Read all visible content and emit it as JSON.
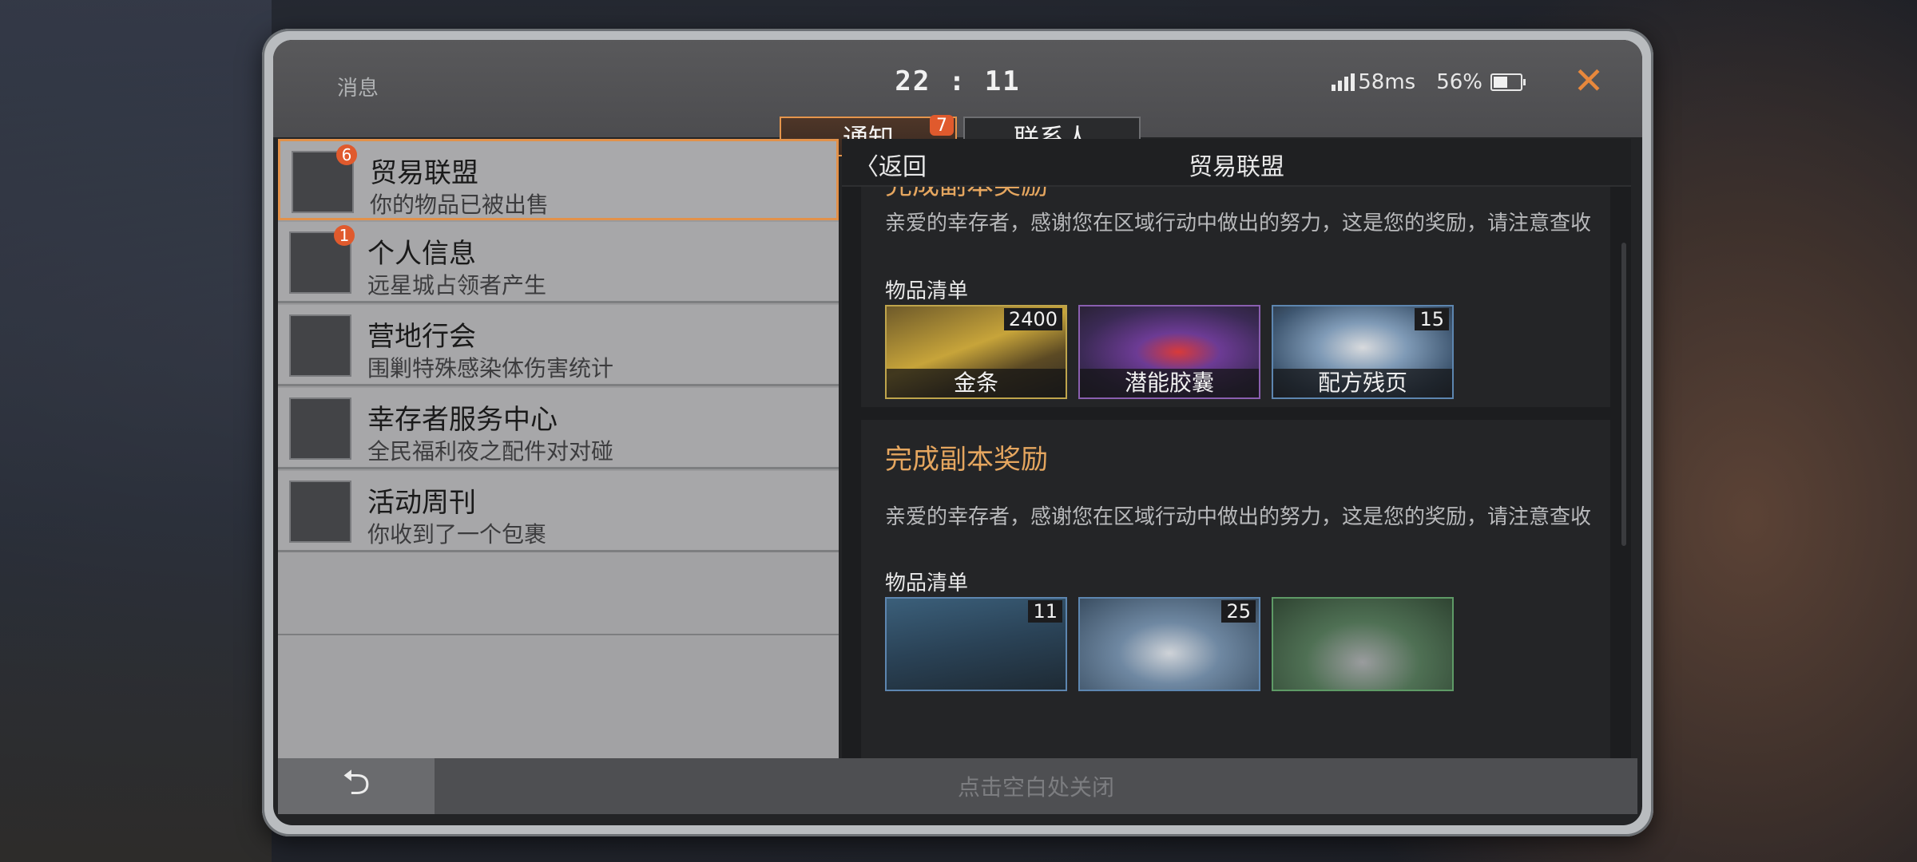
{
  "status_bar": {
    "title": "消息",
    "time": "22 : 11",
    "ping": "58ms",
    "battery": "56%",
    "battery_level": 0.56,
    "close_icon": "close-icon"
  },
  "tabs": [
    {
      "label": "通知",
      "badge": "7",
      "active": true
    },
    {
      "label": "联系人",
      "badge": "",
      "active": false
    }
  ],
  "conversations": [
    {
      "title": "贸易联盟",
      "subtitle": "你的物品已被出售",
      "badge": "6",
      "active": true
    },
    {
      "title": "个人信息",
      "subtitle": "远星城占领者产生",
      "badge": "1",
      "active": false
    },
    {
      "title": "营地行会",
      "subtitle": "围剿特殊感染体伤害统计",
      "badge": "",
      "active": false
    },
    {
      "title": "幸存者服务中心",
      "subtitle": "全民福利夜之配件对对碰",
      "badge": "",
      "active": false
    },
    {
      "title": "活动周刊",
      "subtitle": "你收到了一个包裹",
      "badge": "",
      "active": false
    }
  ],
  "detail": {
    "back_label": "返回",
    "title": "贸易联盟",
    "mails": [
      {
        "title": "完成副本奖励",
        "text": "亲爱的幸存者，感谢您在区域行动中做出的努力，这是您的奖励，请注意查收",
        "items_label": "物品清单",
        "items": [
          {
            "name": "金条",
            "qty": "2400",
            "color": "#bfa54c"
          },
          {
            "name": "潜能胶囊",
            "qty": "",
            "color": "#8a5fb0"
          },
          {
            "name": "配方残页",
            "qty": "15",
            "color": "#5d86b0"
          }
        ]
      },
      {
        "title": "完成副本奖励",
        "text": "亲爱的幸存者，感谢您在区域行动中做出的努力，这是您的奖励，请注意查收",
        "items_label": "物品清单",
        "items": [
          {
            "name": "",
            "qty": "11",
            "color": "#5d86b0"
          },
          {
            "name": "",
            "qty": "25",
            "color": "#5d86b0"
          },
          {
            "name": "",
            "qty": "",
            "color": "#5e9a66"
          }
        ]
      }
    ]
  },
  "bottom": {
    "back_icon": "undo-arrow-icon",
    "close_hint": "点击空白处关闭"
  }
}
